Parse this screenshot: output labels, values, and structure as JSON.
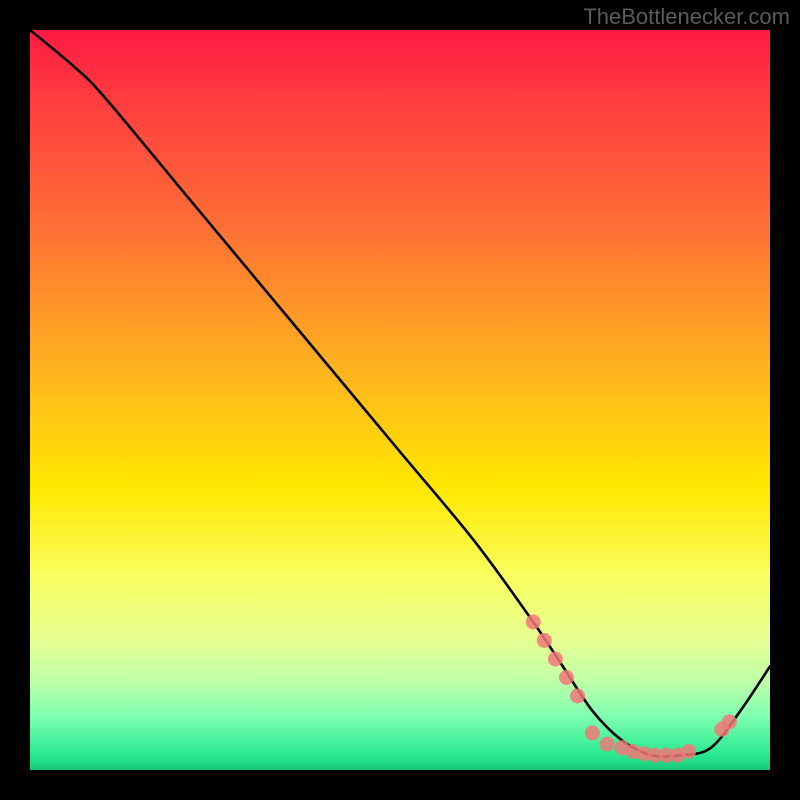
{
  "attribution": "TheBottlenecker.com",
  "chart_data": {
    "type": "line",
    "title": "",
    "xlabel": "",
    "ylabel": "",
    "xlim": [
      0,
      100
    ],
    "ylim": [
      0,
      100
    ],
    "series": [
      {
        "name": "bottleneck-curve",
        "x": [
          0,
          6,
          10,
          20,
          30,
          40,
          50,
          60,
          68,
          72,
          76,
          80,
          84,
          88,
          92,
          96,
          100
        ],
        "values": [
          100,
          95,
          91,
          79,
          67,
          55,
          43,
          31,
          20,
          14,
          8,
          4,
          2,
          2,
          3,
          8,
          14
        ]
      }
    ],
    "markers": [
      {
        "x": 68.0,
        "y": 20.0
      },
      {
        "x": 69.5,
        "y": 17.5
      },
      {
        "x": 71.0,
        "y": 15.0
      },
      {
        "x": 72.5,
        "y": 12.5
      },
      {
        "x": 74.0,
        "y": 10.0
      },
      {
        "x": 76.0,
        "y": 5.0
      },
      {
        "x": 78.0,
        "y": 3.5
      },
      {
        "x": 80.0,
        "y": 3.0
      },
      {
        "x": 81.5,
        "y": 2.5
      },
      {
        "x": 83.0,
        "y": 2.2
      },
      {
        "x": 84.5,
        "y": 2.0
      },
      {
        "x": 86.0,
        "y": 2.0
      },
      {
        "x": 87.5,
        "y": 2.0
      },
      {
        "x": 89.0,
        "y": 2.5
      },
      {
        "x": 93.5,
        "y": 5.5
      },
      {
        "x": 94.5,
        "y": 6.5
      }
    ],
    "gradient_stops": [
      {
        "pos": 0,
        "color": "#ff1a42"
      },
      {
        "pos": 25,
        "color": "#ff6a36"
      },
      {
        "pos": 50,
        "color": "#ffd400"
      },
      {
        "pos": 75,
        "color": "#f8ff60"
      },
      {
        "pos": 100,
        "color": "#18c878"
      }
    ]
  }
}
